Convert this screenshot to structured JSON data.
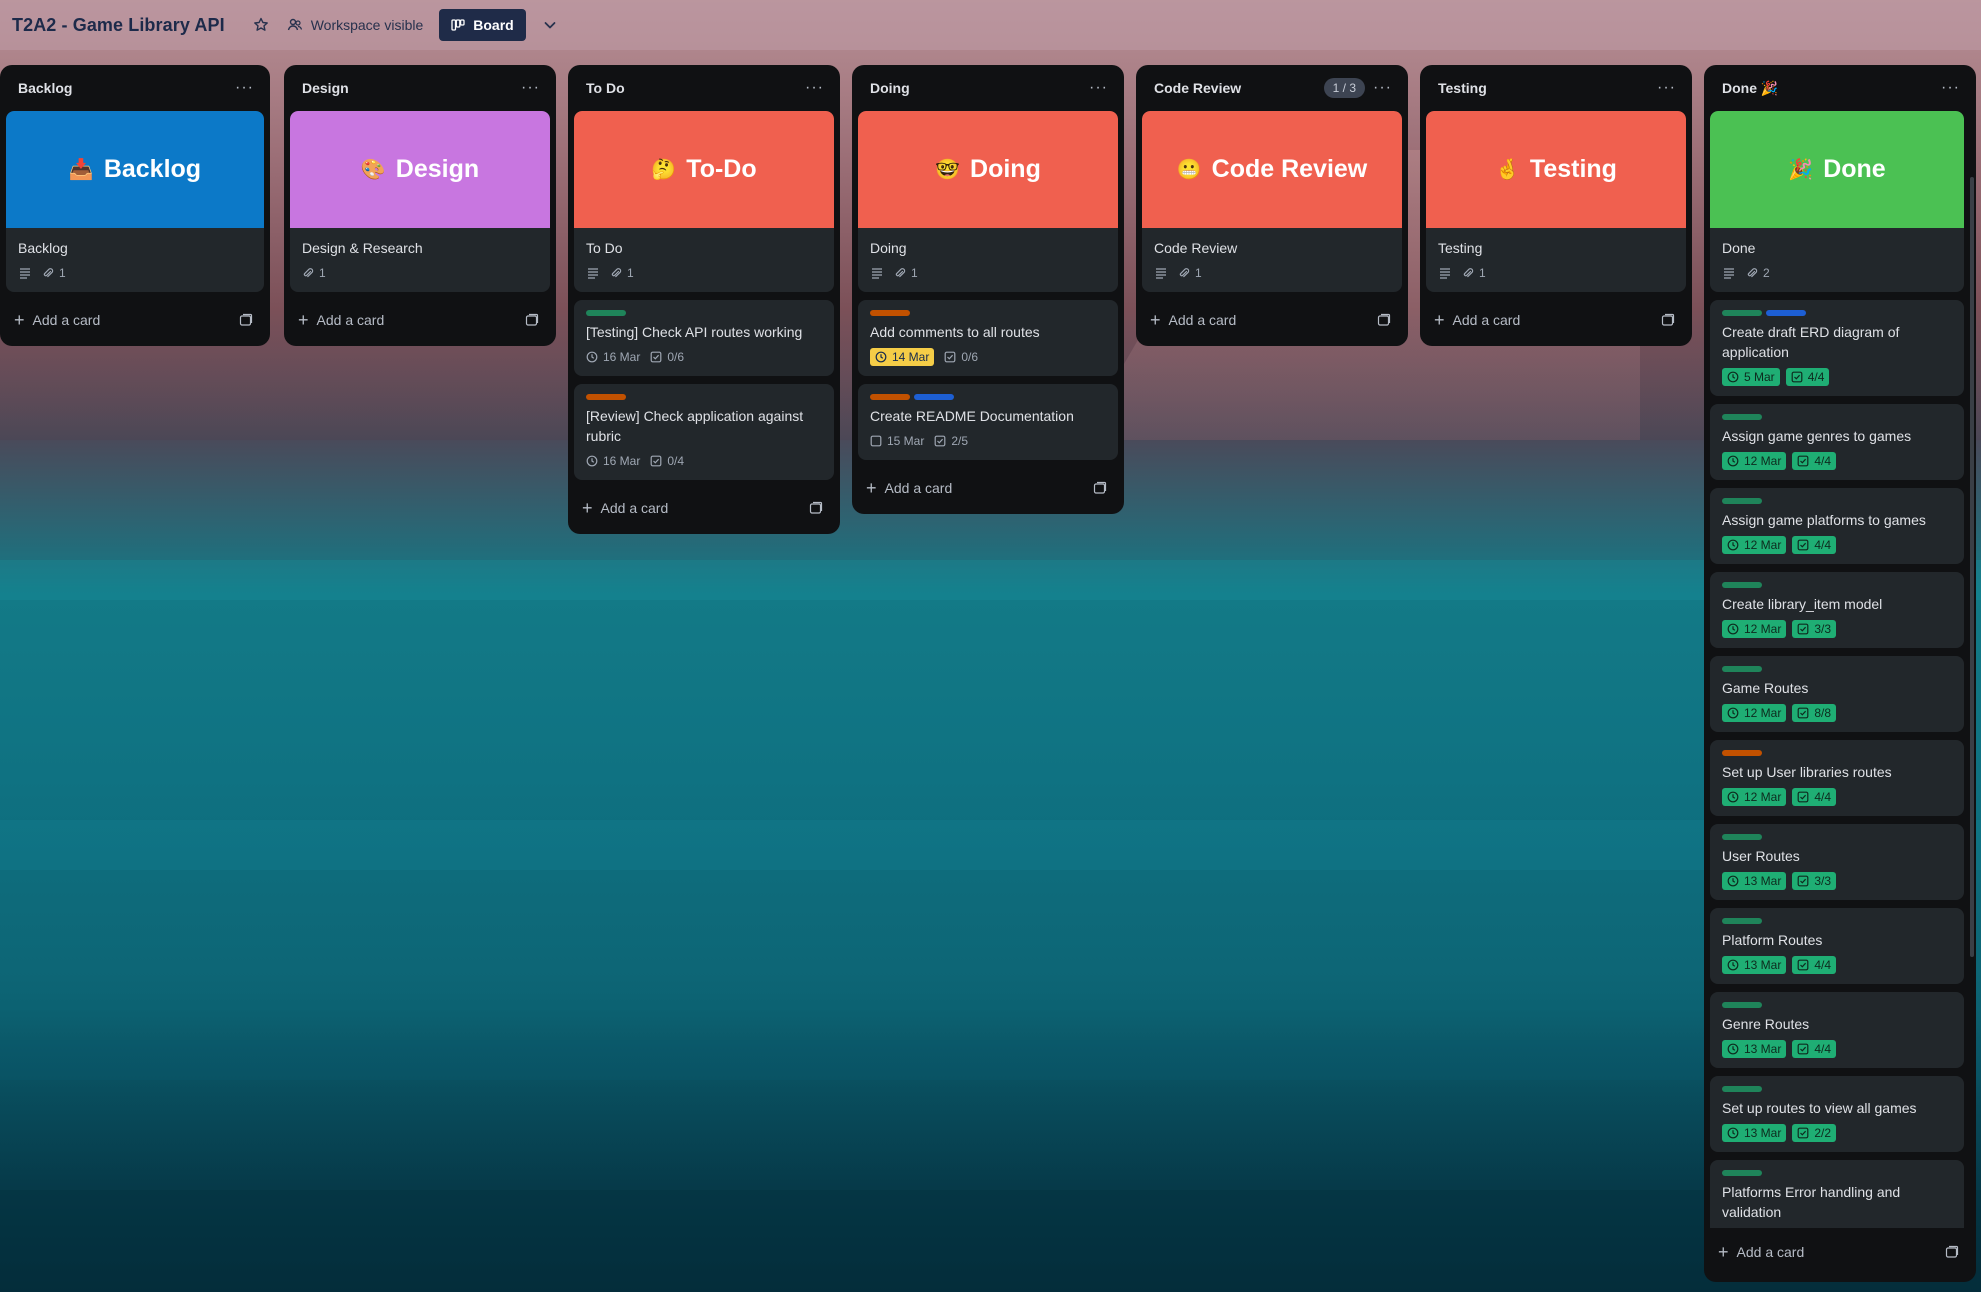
{
  "header": {
    "board_title": "T2A2 - Game Library API",
    "visibility_label": "Workspace visible",
    "view_label": "Board"
  },
  "lists": [
    {
      "title": "Backlog",
      "cover_card": {
        "cover_text": "Backlog",
        "cover_emoji": "📥",
        "cover_color": "#0c79c8",
        "title": "Backlog",
        "attachments": "1"
      },
      "add_label": "Add a card"
    },
    {
      "title": "Design",
      "cover_card": {
        "cover_text": "Design",
        "cover_emoji": "🎨",
        "cover_color": "#c876e0",
        "title": "Design & Research",
        "attachments": "1"
      },
      "add_label": "Add a card"
    },
    {
      "title": "To Do",
      "cover_card": {
        "cover_text": "To-Do",
        "cover_emoji": "🤔",
        "cover_color": "#f0604f",
        "title": "To Do",
        "attachments": "1"
      },
      "cards": [
        {
          "labels": [
            "green"
          ],
          "title": "[Testing] Check API routes working",
          "due": "16 Mar",
          "checklist": "0/6"
        },
        {
          "labels": [
            "orange"
          ],
          "title": "[Review] Check application against rubric",
          "due": "16 Mar",
          "checklist": "0/4"
        }
      ],
      "add_label": "Add a card"
    },
    {
      "title": "Doing",
      "cover_card": {
        "cover_text": "Doing",
        "cover_emoji": "🤓",
        "cover_color": "#f0604f",
        "title": "Doing",
        "attachments": "1"
      },
      "cards": [
        {
          "labels": [
            "orange"
          ],
          "title": "Add comments to all routes",
          "due": "14 Mar",
          "checklist": "0/6"
        },
        {
          "labels": [
            "orange",
            "blue"
          ],
          "title": "Create README Documentation",
          "due": "15 Mar",
          "checklist": "2/5"
        }
      ],
      "add_label": "Add a card"
    },
    {
      "title": "Code Review",
      "count": "1 / 3",
      "cover_card": {
        "cover_text": "Code Review",
        "cover_emoji": "😬",
        "cover_color": "#f0604f",
        "title": "Code Review",
        "attachments": "1"
      },
      "add_label": "Add a card"
    },
    {
      "title": "Testing",
      "cover_card": {
        "cover_text": "Testing",
        "cover_emoji": "🤞",
        "cover_color": "#f0604f",
        "title": "Testing",
        "attachments": "1"
      },
      "add_label": "Add a card"
    },
    {
      "title": "Done 🎉",
      "cover_card": {
        "cover_text": "Done",
        "cover_emoji": "🎉",
        "cover_color": "#4bc153",
        "title": "Done",
        "attachments": "2"
      },
      "cards": [
        {
          "labels": [
            "green",
            "blue"
          ],
          "title": "Create draft ERD diagram of application",
          "due": "5 Mar",
          "checklist": "4/4"
        },
        {
          "labels": [
            "green"
          ],
          "title": "Assign game genres to games",
          "due": "12 Mar",
          "checklist": "4/4"
        },
        {
          "labels": [
            "green"
          ],
          "title": "Assign game platforms to games",
          "due": "12 Mar",
          "checklist": "4/4"
        },
        {
          "labels": [
            "green"
          ],
          "title": "Create library_item model",
          "due": "12 Mar",
          "checklist": "3/3"
        },
        {
          "labels": [
            "green"
          ],
          "title": "Game Routes",
          "due": "12 Mar",
          "checklist": "8/8"
        },
        {
          "labels": [
            "orange"
          ],
          "title": "Set up User libraries routes",
          "due": "12 Mar",
          "checklist": "4/4"
        },
        {
          "labels": [
            "green"
          ],
          "title": "User Routes",
          "due": "13 Mar",
          "checklist": "3/3"
        },
        {
          "labels": [
            "green"
          ],
          "title": "Platform Routes",
          "due": "13 Mar",
          "checklist": "4/4"
        },
        {
          "labels": [
            "green"
          ],
          "title": "Genre Routes",
          "due": "13 Mar",
          "checklist": "4/4"
        },
        {
          "labels": [
            "green"
          ],
          "title": "Set up routes to view all games",
          "due": "13 Mar",
          "checklist": "2/2"
        },
        {
          "labels": [
            "green"
          ],
          "title": "Platforms Error handling and validation",
          "due": "",
          "checklist": ""
        }
      ],
      "add_label": "Add a card"
    }
  ]
}
